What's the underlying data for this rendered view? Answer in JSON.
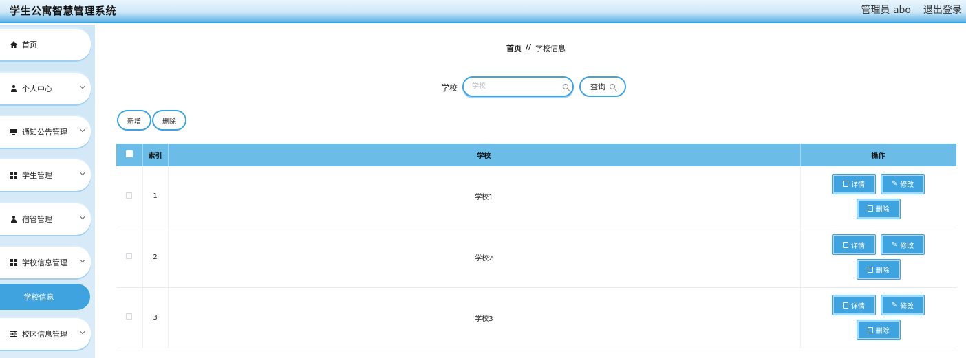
{
  "app": {
    "title": "学生公寓智慧管理系统",
    "user": "管理员 abo",
    "logout": "退出登录"
  },
  "sidebar": {
    "items": [
      {
        "label": "首页",
        "icon": "home-icon"
      },
      {
        "label": "个人中心",
        "icon": "person-icon"
      },
      {
        "label": "通知公告管理",
        "icon": "monitor-icon"
      },
      {
        "label": "学生管理",
        "icon": "grid-icon"
      },
      {
        "label": "宿管管理",
        "icon": "person-icon"
      },
      {
        "label": "学校信息管理",
        "icon": "grid-icon"
      },
      {
        "label": "校区信息管理",
        "icon": "sliders-icon"
      }
    ],
    "active_sub": "学校信息"
  },
  "breadcrumb": {
    "home": "首页",
    "sep": "//",
    "current": "学校信息"
  },
  "search": {
    "label": "学校",
    "placeholder": "学校",
    "button": "查询"
  },
  "actions": {
    "add": "新增",
    "delete": "删除"
  },
  "table": {
    "headers": {
      "index": "索引",
      "school": "学校",
      "ops": "操作"
    },
    "rows": [
      {
        "index": "1",
        "school": "学校1"
      },
      {
        "index": "2",
        "school": "学校2"
      },
      {
        "index": "3",
        "school": "学校3"
      }
    ],
    "op_labels": {
      "detail": "详情",
      "edit": "修改",
      "delete": "删除"
    }
  },
  "colors": {
    "accent": "#3ea3df",
    "header": "#6bbde8"
  }
}
